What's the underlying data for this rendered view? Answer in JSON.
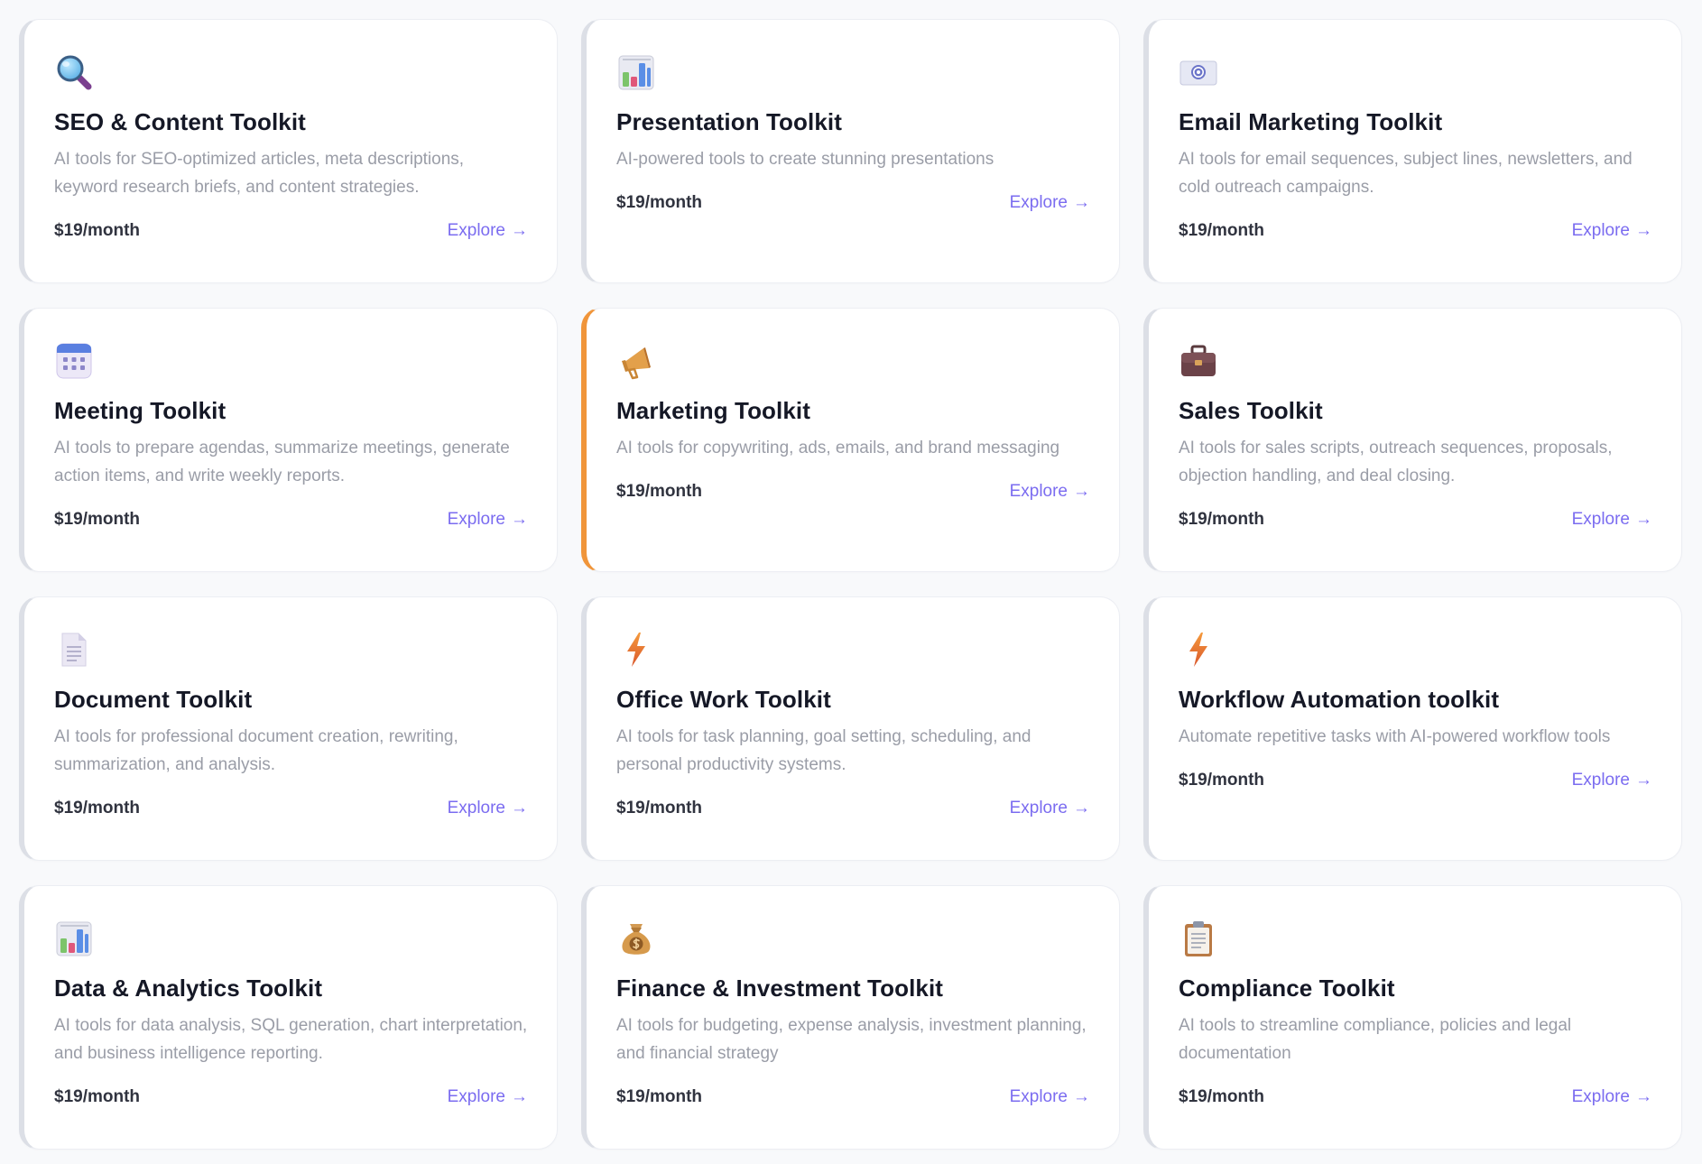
{
  "price_label": "$19/month",
  "explore_label": "Explore",
  "arrow_glyph": "→",
  "accent_color": "#7b6cf0",
  "active_border_color": "#f0953a",
  "cards": [
    {
      "icon": "magnifier-icon",
      "title": "SEO & Content Toolkit",
      "description": "AI tools for SEO-optimized articles, meta descriptions, keyword research briefs, and content strategies.",
      "price": "$19/month",
      "explore": "Explore",
      "arrow": "→"
    },
    {
      "icon": "bar-chart-icon",
      "title": "Presentation Toolkit",
      "description": "AI-powered tools to create stunning presentations",
      "price": "$19/month",
      "explore": "Explore",
      "arrow": "→"
    },
    {
      "icon": "email-icon",
      "title": "Email Marketing Toolkit",
      "description": "AI tools for email sequences, subject lines, newsletters, and cold outreach campaigns.",
      "price": "$19/month",
      "explore": "Explore",
      "arrow": "→"
    },
    {
      "icon": "calendar-icon",
      "title": "Meeting Toolkit",
      "description": "AI tools to prepare agendas, summarize meetings, generate action items, and write weekly reports.",
      "price": "$19/month",
      "explore": "Explore",
      "arrow": "→"
    },
    {
      "icon": "megaphone-icon",
      "title": "Marketing Toolkit",
      "description": "AI tools for copywriting, ads, emails, and brand messaging",
      "price": "$19/month",
      "explore": "Explore",
      "arrow": "→",
      "active": true
    },
    {
      "icon": "briefcase-icon",
      "title": "Sales Toolkit",
      "description": "AI tools for sales scripts, outreach sequences, proposals, objection handling, and deal closing.",
      "price": "$19/month",
      "explore": "Explore",
      "arrow": "→"
    },
    {
      "icon": "document-icon",
      "title": "Document Toolkit",
      "description": "AI tools for professional document creation, rewriting, summarization, and analysis.",
      "price": "$19/month",
      "explore": "Explore",
      "arrow": "→"
    },
    {
      "icon": "lightning-icon",
      "title": "Office Work Toolkit",
      "description": "AI tools for task planning, goal setting, scheduling, and personal productivity systems.",
      "price": "$19/month",
      "explore": "Explore",
      "arrow": "→"
    },
    {
      "icon": "lightning-icon",
      "title": "Workflow Automation toolkit",
      "description": "Automate repetitive tasks with AI-powered workflow tools",
      "price": "$19/month",
      "explore": "Explore",
      "arrow": "→"
    },
    {
      "icon": "bar-chart-icon",
      "title": "Data & Analytics Toolkit",
      "description": "AI tools for data analysis, SQL generation, chart interpretation, and business intelligence reporting.",
      "price": "$19/month",
      "explore": "Explore",
      "arrow": "→"
    },
    {
      "icon": "money-bag-icon",
      "title": "Finance & Investment Toolkit",
      "description": "AI tools for budgeting, expense analysis, investment planning, and financial strategy",
      "price": "$19/month",
      "explore": "Explore",
      "arrow": "→"
    },
    {
      "icon": "clipboard-icon",
      "title": "Compliance Toolkit",
      "description": "AI tools to streamline compliance, policies and legal documentation",
      "price": "$19/month",
      "explore": "Explore",
      "arrow": "→"
    }
  ]
}
